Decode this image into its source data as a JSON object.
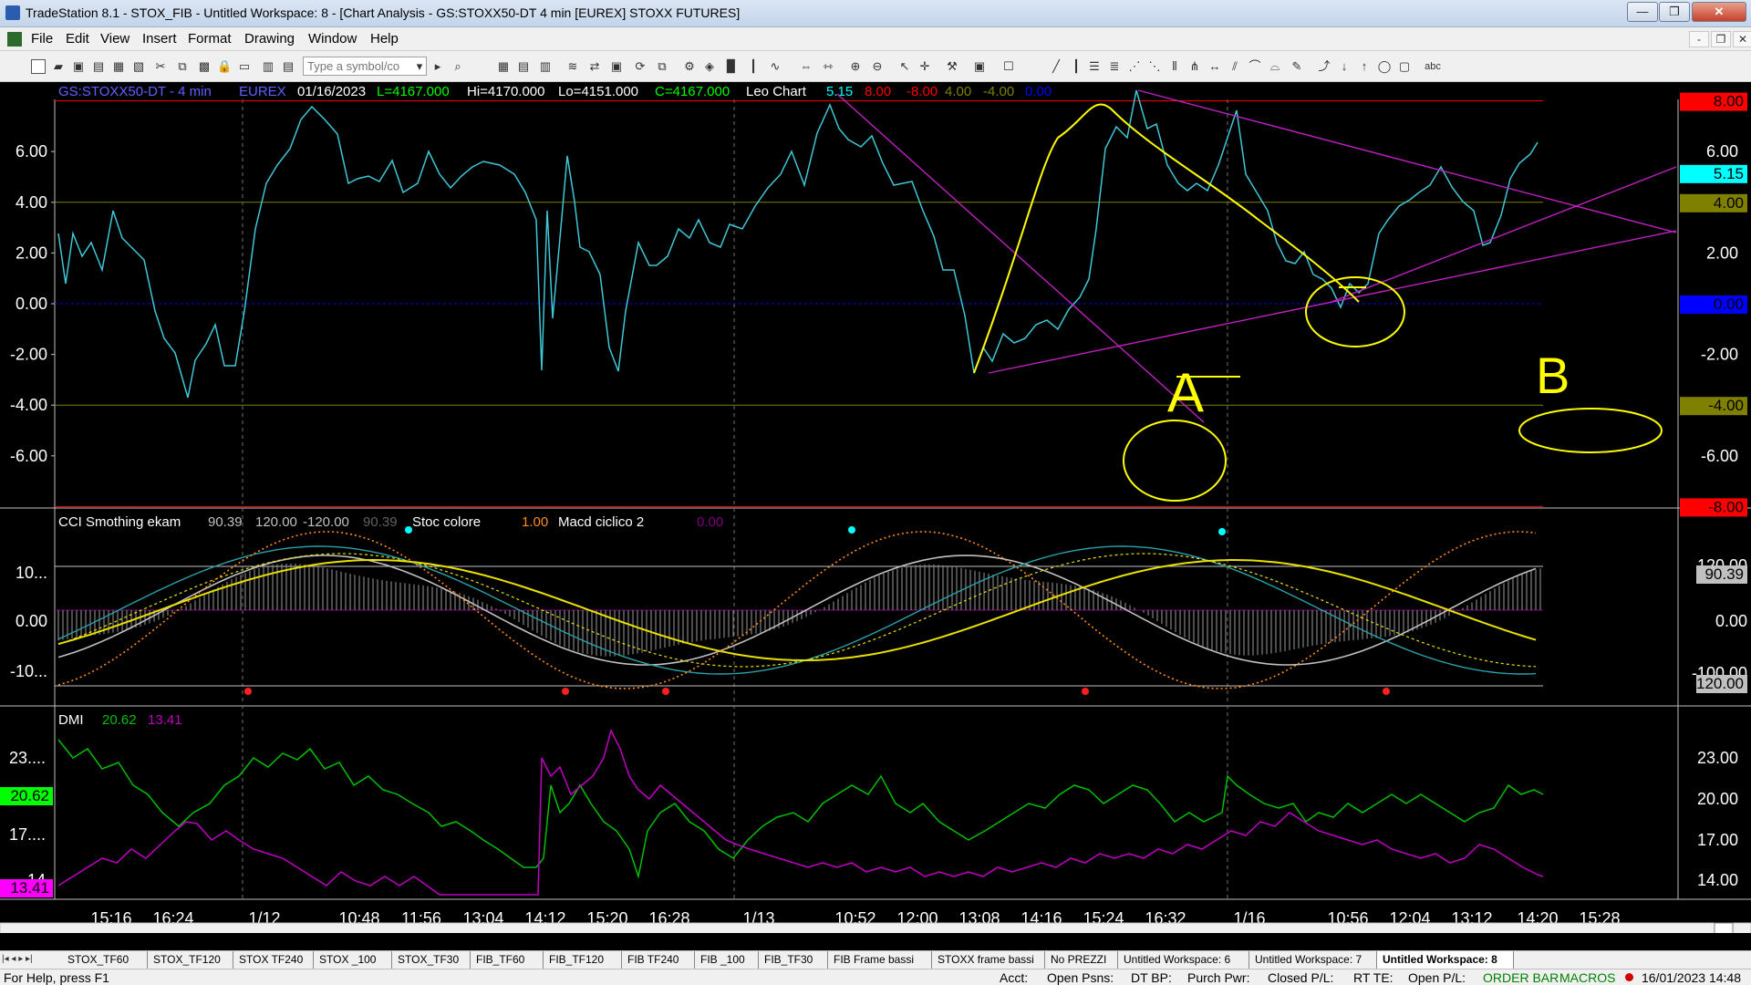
{
  "window": {
    "title": "TradeStation 8.1 - STOX_FIB - Untitled Workspace:  8 - [Chart Analysis - GS:STOXX50-DT  4 min  [EUREX] STOXX FUTURES]",
    "min": "—",
    "max": "❐",
    "close": "✕"
  },
  "menu": [
    "File",
    "Edit",
    "View",
    "Insert",
    "Format",
    "Drawing",
    "Window",
    "Help"
  ],
  "menu_doc": [
    "-",
    "❐",
    "✕"
  ],
  "toolbar": {
    "symbol_placeholder": "Type a symbol/co",
    "text_tool": "abc"
  },
  "chart": {
    "header": {
      "symbol": "GS:STOXX50-DT - 4 min",
      "exchange": "EUREX",
      "date": "01/16/2023",
      "last": "L=4167.000",
      "high": "Hi=4170.000",
      "low": "Lo=4151.000",
      "close": "C=4167.000",
      "indicator": "Leo Chart",
      "v1": "5.15",
      "v2": "8.00",
      "v3": "-8.00",
      "v4": "4.00",
      "v5": "-4.00",
      "v6": "0.00"
    },
    "panel1_left_ticks": [
      "6.00",
      "4.00",
      "2.00",
      "0.00",
      "-2.00",
      "-4.00",
      "-6.00"
    ],
    "panel1_right_ticks": [
      "6.00",
      "2.00",
      "-2.00",
      "-6.00"
    ],
    "panel1_right_badges": [
      {
        "text": "8.00",
        "bg": "#ff0000",
        "fg": "#000000"
      },
      {
        "text": "5.15",
        "bg": "#00ffff",
        "fg": "#000000"
      },
      {
        "text": "4.00",
        "bg": "#808000",
        "fg": "#000000"
      },
      {
        "text": "0.00",
        "bg": "#0000ff",
        "fg": "#000000"
      },
      {
        "text": "-4.00",
        "bg": "#808000",
        "fg": "#000000"
      },
      {
        "text": "-8.00",
        "bg": "#ff0000",
        "fg": "#000000"
      }
    ],
    "panel2_header": {
      "cci": "CCI Smothing ekam",
      "cci_v1": "90.39",
      "cci_v2": "120.00",
      "cci_v3": "-120.00",
      "cci_v4": "90.39",
      "stoc": "Stoc colore",
      "stoc_v": "1.00",
      "macd": "Macd ciclico 2",
      "macd_v": "0.00"
    },
    "panel2_left_ticks": [
      "10...",
      "0.00",
      "-10..."
    ],
    "panel2_right_ticks": [
      "120.00",
      "0.00",
      "-100.00"
    ],
    "panel2_right_badges": [
      {
        "text": "90.39",
        "bg": "#c0c0c0",
        "fg": "#000000"
      },
      {
        "text": "-120.00",
        "bg": "#c0c0c0",
        "fg": "#000000"
      }
    ],
    "panel3_header": {
      "name": "DMI",
      "v1": "20.62",
      "v2": "13.41"
    },
    "panel3_left_ticks": [
      "23....",
      "17....",
      "14"
    ],
    "panel3_right_ticks": [
      "23.00",
      "20.00",
      "17.00",
      "14.00"
    ],
    "panel3_left_badges": [
      {
        "text": "20.62",
        "bg": "#00ff00",
        "fg": "#000000"
      },
      {
        "text": "13.41",
        "bg": "#ff00ff",
        "fg": "#000000"
      }
    ],
    "time_labels": [
      "15:16",
      "16:24",
      "1/12",
      "10:48",
      "11:56",
      "13:04",
      "14:12",
      "15:20",
      "16:28",
      "1/13",
      "10:52",
      "12:00",
      "13:08",
      "14:16",
      "15:24",
      "16:32",
      "1/16",
      "10:56",
      "12:04",
      "13:12",
      "14:20",
      "15:28"
    ],
    "annotations": {
      "a": "A",
      "b": "B"
    },
    "colors": {
      "price": "#3fc7d6",
      "trend": "#c020c0",
      "marker": "#ffff00",
      "plus_di": "#00c000",
      "minus_di": "#c000c0",
      "stoch": "#ff8c1a"
    }
  },
  "tabs": [
    "STOX_TF60",
    "STOX_TF120",
    "STOX TF240",
    "STOX _100",
    "STOX_TF30",
    "FIB_TF60",
    "FIB_TF120",
    "FIB TF240",
    "FIB _100",
    "FIB_TF30",
    "FIB Frame bassi",
    "STOXX frame bassi",
    "No PREZZI",
    "Untitled Workspace:  6",
    "Untitled Workspace:  7",
    "Untitled Workspace:  8"
  ],
  "status": {
    "help": "For Help, press F1",
    "acct": "Acct:",
    "open_psns": "Open Psns:",
    "dt_bp": "DT BP:",
    "purch_pwr": "Purch Pwr:",
    "closed_pl": "Closed P/L:",
    "rt_te": "RT TE:",
    "open_pl": "Open P/L:",
    "order_bar": "ORDER BAR",
    "macros": "MACROS",
    "datetime": "16/01/2023 14:48"
  }
}
